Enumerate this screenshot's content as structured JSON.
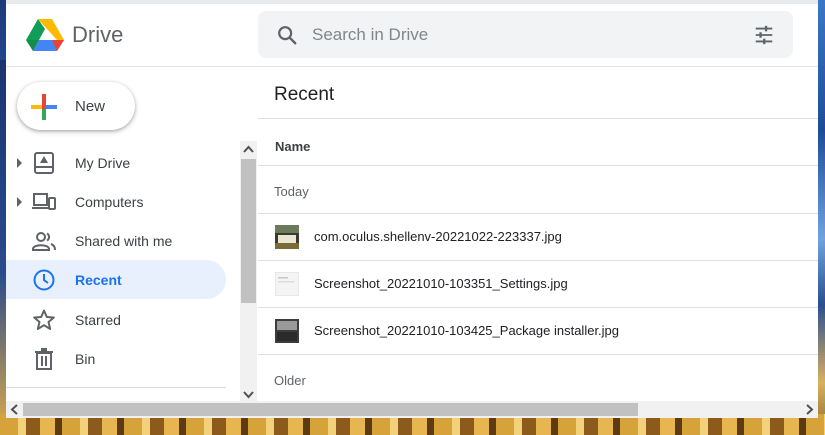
{
  "app": {
    "title": "Drive"
  },
  "search": {
    "placeholder": "Search in Drive"
  },
  "new_button": {
    "label": "New"
  },
  "sidebar": {
    "items": [
      {
        "label": "My Drive",
        "icon": "my-drive-icon",
        "expandable": true,
        "active": false
      },
      {
        "label": "Computers",
        "icon": "computers-icon",
        "expandable": true,
        "active": false
      },
      {
        "label": "Shared with me",
        "icon": "shared-icon",
        "expandable": false,
        "active": false
      },
      {
        "label": "Recent",
        "icon": "clock-icon",
        "expandable": false,
        "active": true
      },
      {
        "label": "Starred",
        "icon": "star-icon",
        "expandable": false,
        "active": false
      },
      {
        "label": "Bin",
        "icon": "trash-icon",
        "expandable": false,
        "active": false
      }
    ]
  },
  "main": {
    "title": "Recent",
    "column_header": "Name",
    "groups": [
      {
        "label": "Today",
        "files": [
          {
            "name": "com.oculus.shellenv-20221022-223337.jpg",
            "thumb": "photo"
          },
          {
            "name": "Screenshot_20221010-103351_Settings.jpg",
            "thumb": "light"
          },
          {
            "name": "Screenshot_20221010-103425_Package installer.jpg",
            "thumb": "dark"
          }
        ]
      },
      {
        "label": "Older",
        "files": []
      }
    ]
  },
  "colors": {
    "accent": "#1a73e8",
    "active_nav_bg": "#e8f0fe",
    "search_bg": "#f1f3f4",
    "text_primary": "#202124",
    "text_secondary": "#5f6368"
  }
}
